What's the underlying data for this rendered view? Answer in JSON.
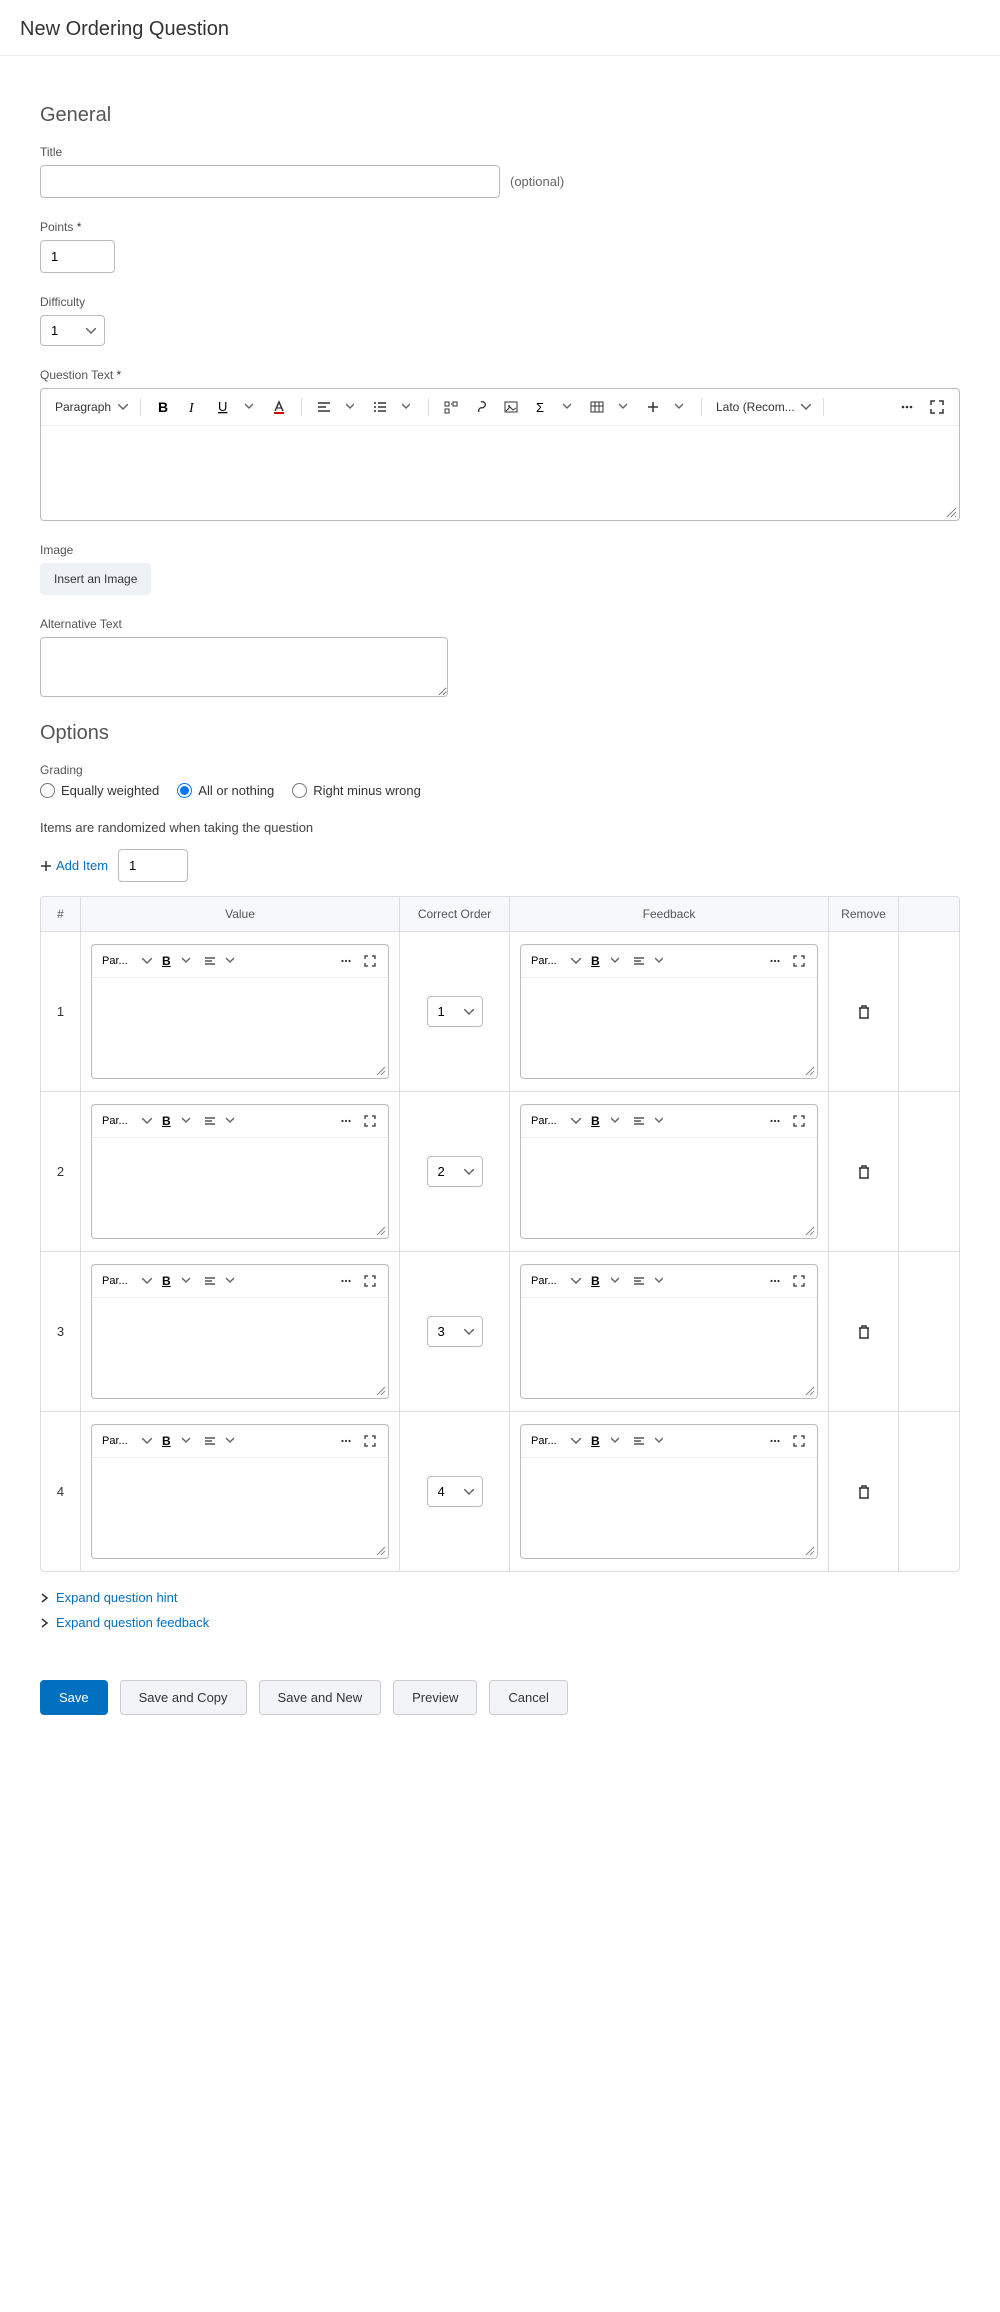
{
  "header": {
    "title": "New Ordering Question"
  },
  "sections": {
    "general": "General",
    "options": "Options"
  },
  "labels": {
    "title": "Title",
    "optional": "(optional)",
    "points": "Points",
    "difficulty": "Difficulty",
    "question_text": "Question Text",
    "image": "Image",
    "insert_image": "Insert an Image",
    "alt_text": "Alternative Text",
    "grading": "Grading",
    "randomized_note": "Items are randomized when taking the question",
    "add_item": "Add Item"
  },
  "values": {
    "title": "",
    "points": "1",
    "difficulty": "1",
    "add_item_count": "1"
  },
  "rte": {
    "paragraph": "Paragraph",
    "font": "Lato (Recom...",
    "mini_paragraph": "Par..."
  },
  "grading": {
    "options": {
      "equally": "Equally weighted",
      "all": "All or nothing",
      "rmw": "Right minus wrong"
    },
    "selected": "all"
  },
  "table": {
    "headers": {
      "num": "#",
      "value": "Value",
      "order": "Correct Order",
      "feedback": "Feedback",
      "remove": "Remove"
    },
    "rows": [
      {
        "num": "1",
        "order": "1"
      },
      {
        "num": "2",
        "order": "2"
      },
      {
        "num": "3",
        "order": "3"
      },
      {
        "num": "4",
        "order": "4"
      }
    ]
  },
  "expanders": {
    "hint": "Expand question hint",
    "feedback": "Expand question feedback"
  },
  "actions": {
    "save": "Save",
    "save_copy": "Save and Copy",
    "save_new": "Save and New",
    "preview": "Preview",
    "cancel": "Cancel"
  }
}
